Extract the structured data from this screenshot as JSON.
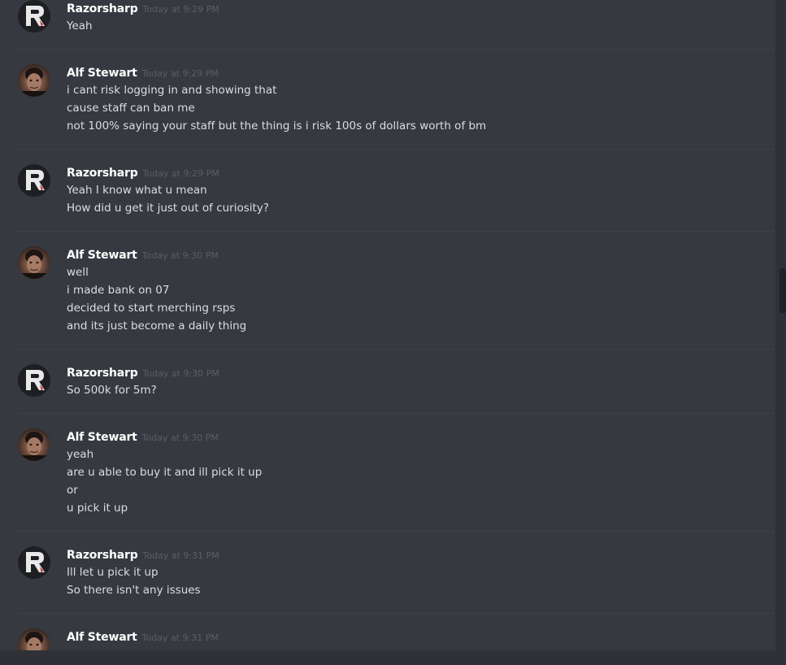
{
  "messages": [
    {
      "author": "Razorsharp",
      "timestamp": "Today at 9:29 PM",
      "avatar": "razorsharp-r-logo-icon",
      "lines": [
        "Yeah"
      ]
    },
    {
      "author": "Alf Stewart",
      "timestamp": "Today at 9:29 PM",
      "avatar": "alf-stewart-photo-avatar",
      "lines": [
        "i cant risk logging in and showing that",
        "cause staff can ban me",
        "not 100% saying your staff but the thing is i risk 100s of dollars worth of bm"
      ]
    },
    {
      "author": "Razorsharp",
      "timestamp": "Today at 9:29 PM",
      "avatar": "razorsharp-r-logo-icon",
      "lines": [
        "Yeah I know what u mean",
        "How did u get it just out of curiosity?"
      ]
    },
    {
      "author": "Alf Stewart",
      "timestamp": "Today at 9:30 PM",
      "avatar": "alf-stewart-photo-avatar",
      "lines": [
        "well",
        "i made bank on 07",
        "decided to start merching rsps",
        "and its just become a daily thing"
      ]
    },
    {
      "author": "Razorsharp",
      "timestamp": "Today at 9:30 PM",
      "avatar": "razorsharp-r-logo-icon",
      "lines": [
        "So 500k for 5m?"
      ]
    },
    {
      "author": "Alf Stewart",
      "timestamp": "Today at 9:30 PM",
      "avatar": "alf-stewart-photo-avatar",
      "lines": [
        "yeah",
        "are u able to buy it and ill pick it up",
        "or",
        "u pick it up"
      ]
    },
    {
      "author": "Razorsharp",
      "timestamp": "Today at 9:31 PM",
      "avatar": "razorsharp-r-logo-icon",
      "lines": [
        "Ill let u pick it up",
        "So there isn't any issues"
      ]
    },
    {
      "author": "Alf Stewart",
      "timestamp": "Today at 9:31 PM",
      "avatar": "alf-stewart-photo-avatar",
      "lines": []
    }
  ],
  "colors": {
    "background": "#36393f",
    "username": "#ffffff",
    "timestamp": "#5b5e63",
    "message_text": "#dcddde",
    "divider": "#3e4147"
  }
}
